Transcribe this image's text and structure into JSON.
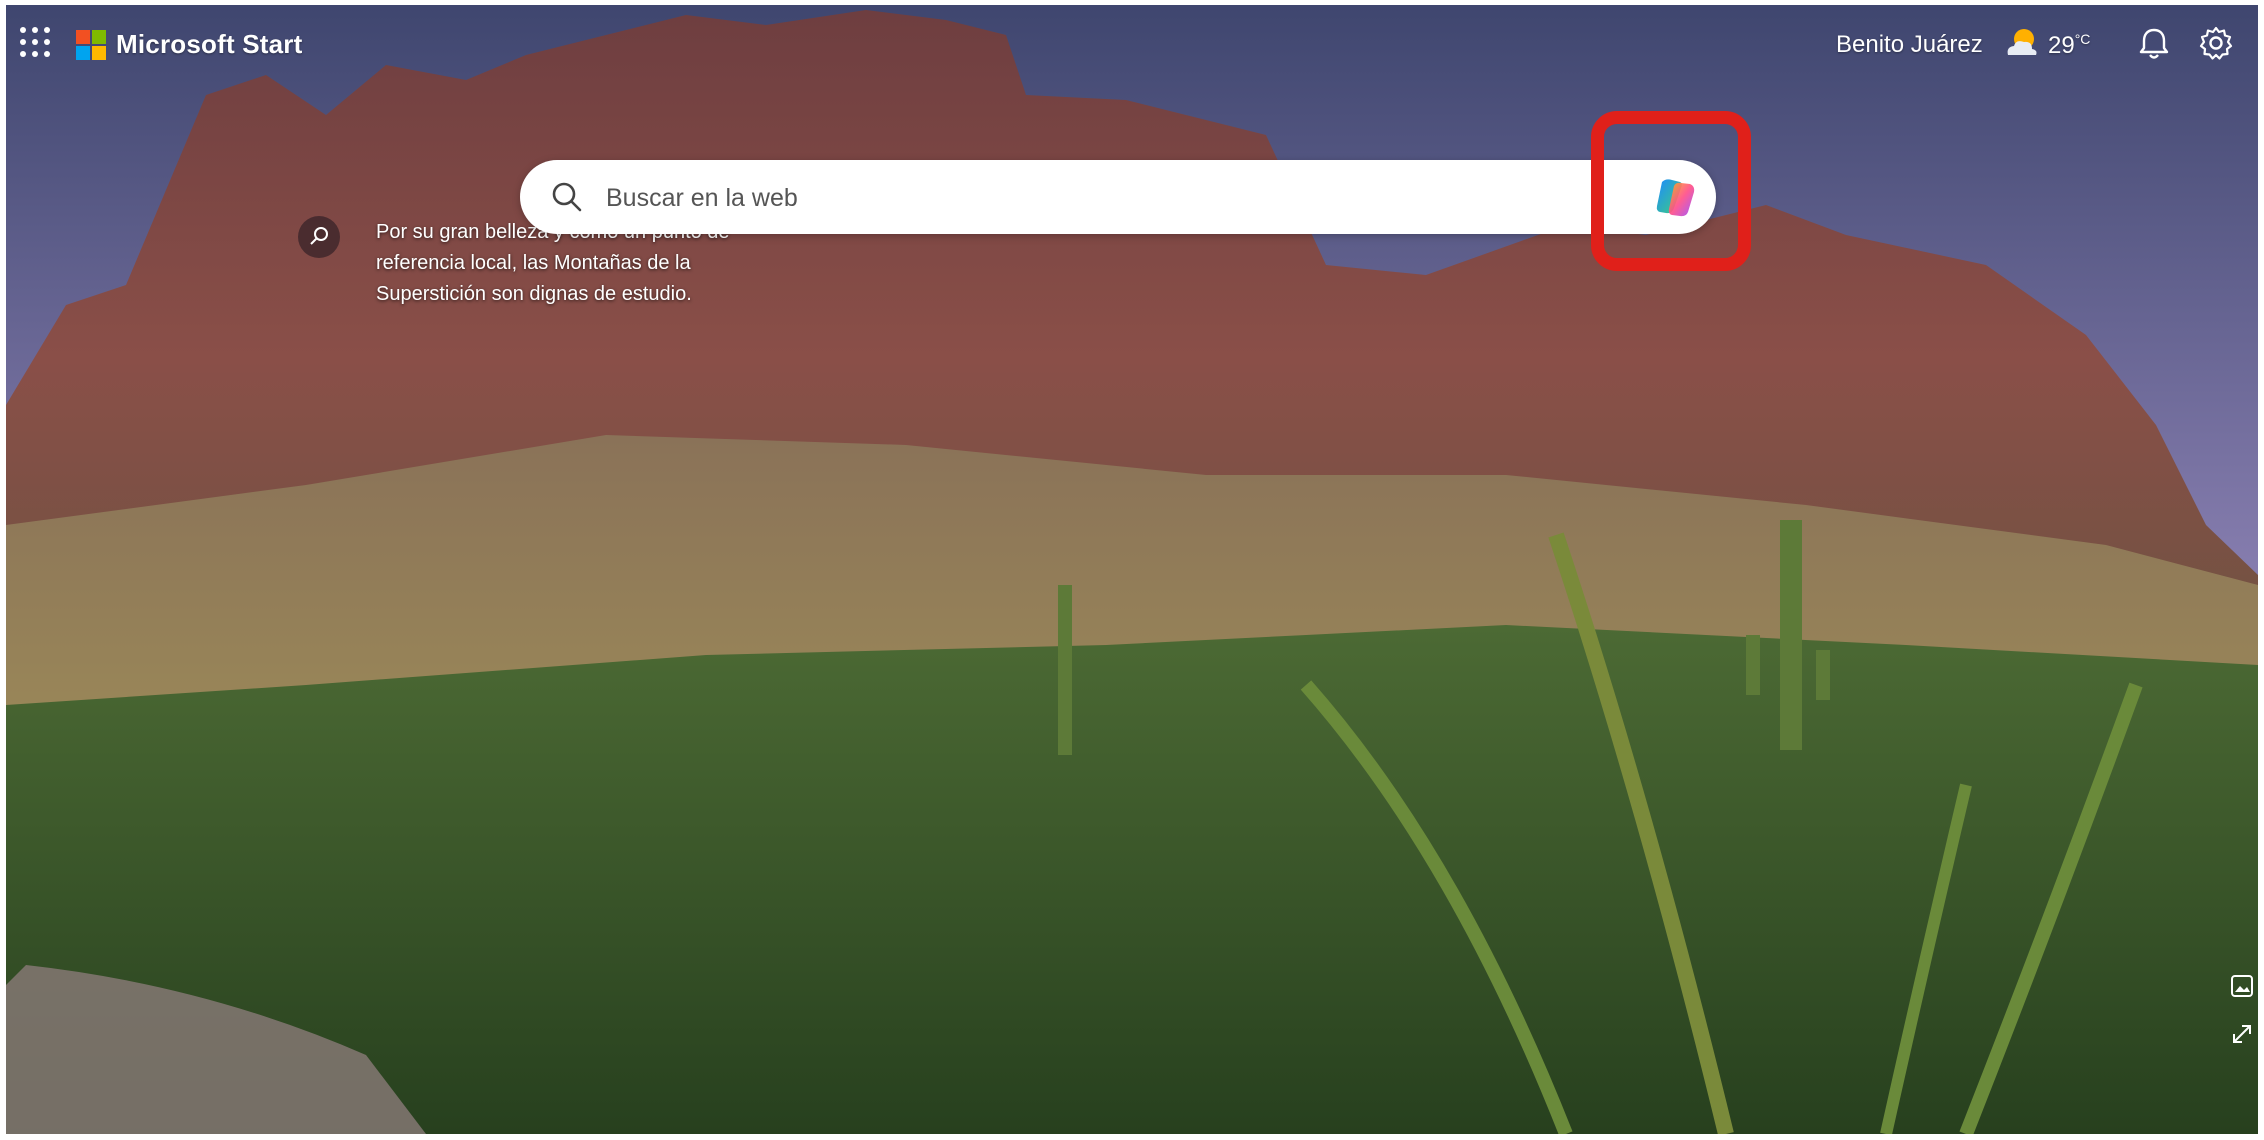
{
  "header": {
    "brand": "Microsoft Start",
    "location": "Benito Juárez",
    "temperature": "29",
    "temperature_unit": "°C"
  },
  "search": {
    "placeholder": "Buscar en la web"
  },
  "background": {
    "caption": "Por su gran belleza y como un punto de referencia local, las Montañas de la Superstición son dignas de estudio."
  },
  "icons": [
    "apps-grid-icon",
    "microsoft-logo-icon",
    "weather-partly-sunny-icon",
    "bell-icon",
    "settings-gear-icon",
    "search-icon",
    "copilot-icon",
    "image-info-icon",
    "expand-icon"
  ],
  "colors": {
    "highlight": "#e0201a",
    "logo_red": "#f25022",
    "logo_green": "#7fba00",
    "logo_blue": "#00a4ef",
    "logo_yellow": "#ffb900"
  }
}
